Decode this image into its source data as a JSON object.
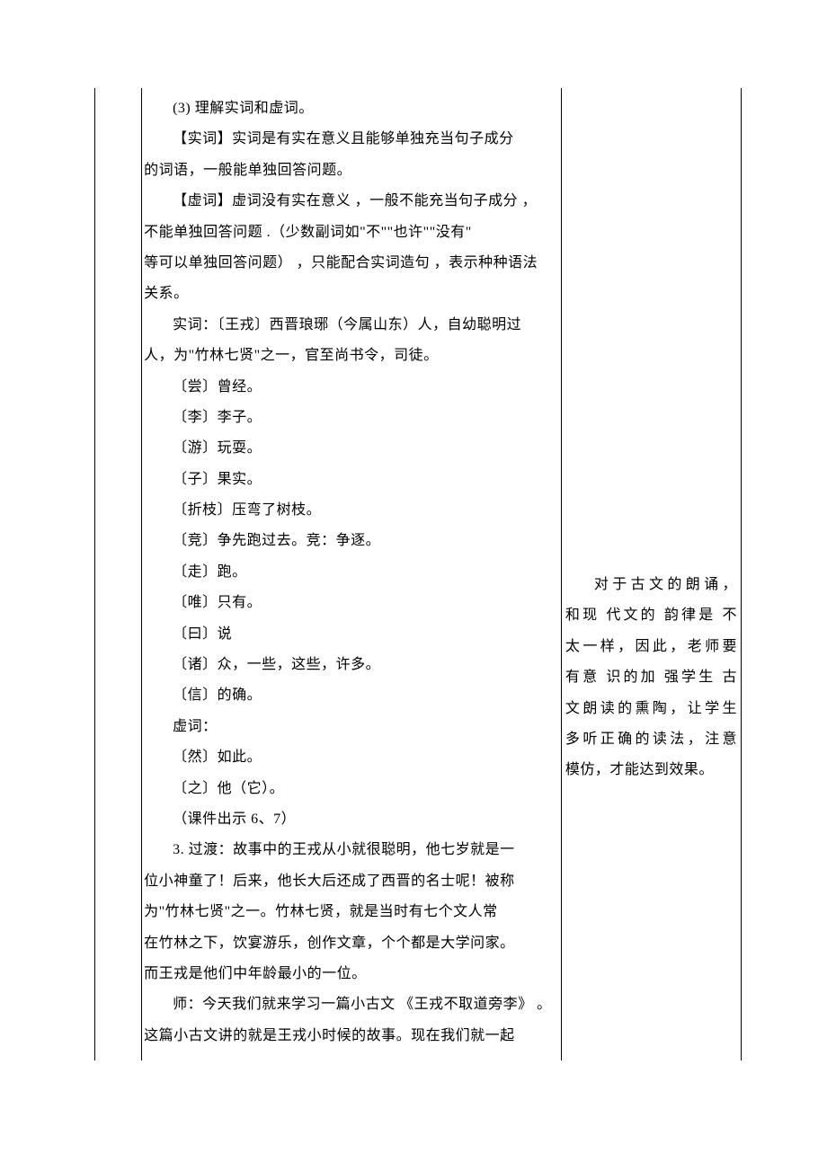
{
  "main": {
    "p1": "(3) 理解实词和虚词。",
    "p2": "【实词】实词是有实在意义且能够单独充当句子成分",
    "p2b": "的词语，一般能单独回答问题。",
    "p3": "【虚词】虚词没有实在意义  ，一般不能充当句子成分   ，",
    "p3b": "不能单独回答问题  .（少数副词如\"不\"\"也许\"\"没有\"",
    "p3c": "等可以单独回答问题）   ，只能配合实词造句  ，表示种种语法",
    "p3d": "关系。",
    "p4": "实词：〔王戎〕西晋琅琊（今属山东）人，自幼聪明过",
    "p4b": "人，为\"竹林七贤\"之一，官至尚书令，司徒。",
    "li1": "〔尝〕曾经。",
    "li2": "〔李〕李子。",
    "li3": "〔游〕玩耍。",
    "li4": "〔子〕果实。",
    "li5": "〔折枝〕压弯了树枝。",
    "li6": "〔竞〕争先跑过去。竞：争逐。",
    "li7": "〔走〕跑。",
    "li8": "〔唯〕只有。",
    "li9": "〔曰〕说",
    "li10": "〔诸〕众，一些，这些，许多。",
    "li11": "〔信〕的确。",
    "p5": "虚词：",
    "li12": "〔然〕如此。",
    "li13": "〔之〕他（它）。",
    "p6": "（课件出示 6、7）",
    "p7": "3. 过渡：故事中的王戎从小就很聪明，他七岁就是一",
    "p7b": "位小神童了！后来，他长大后还成了西晋的名士呢！被称",
    "p7c": "为\"竹林七贤\"之一。竹林七贤，就是当时有七个文人常",
    "p7d": "在竹林之下，饮宴游乐，创作文章，个个都是大学问家。",
    "p7e": "而王戎是他们中年龄最小的一位。",
    "p8": "师：今天我们就来学习一篇小古文  《王戎不取道旁李》 。",
    "p8b": "这篇小古文讲的就是王戎小时候的故事。现在我们就一起"
  },
  "side": {
    "s1": "对于古文的朗诵，",
    "s2": "和现 代文的 韵律是 不",
    "s3": "太一样，因此，老师要",
    "s4": "有意 识的加 强学生 古",
    "s5": "文朗读的熏陶，让学生",
    "s6": "多听正确的读法，注意",
    "s7": "模仿，才能达到效果。"
  }
}
